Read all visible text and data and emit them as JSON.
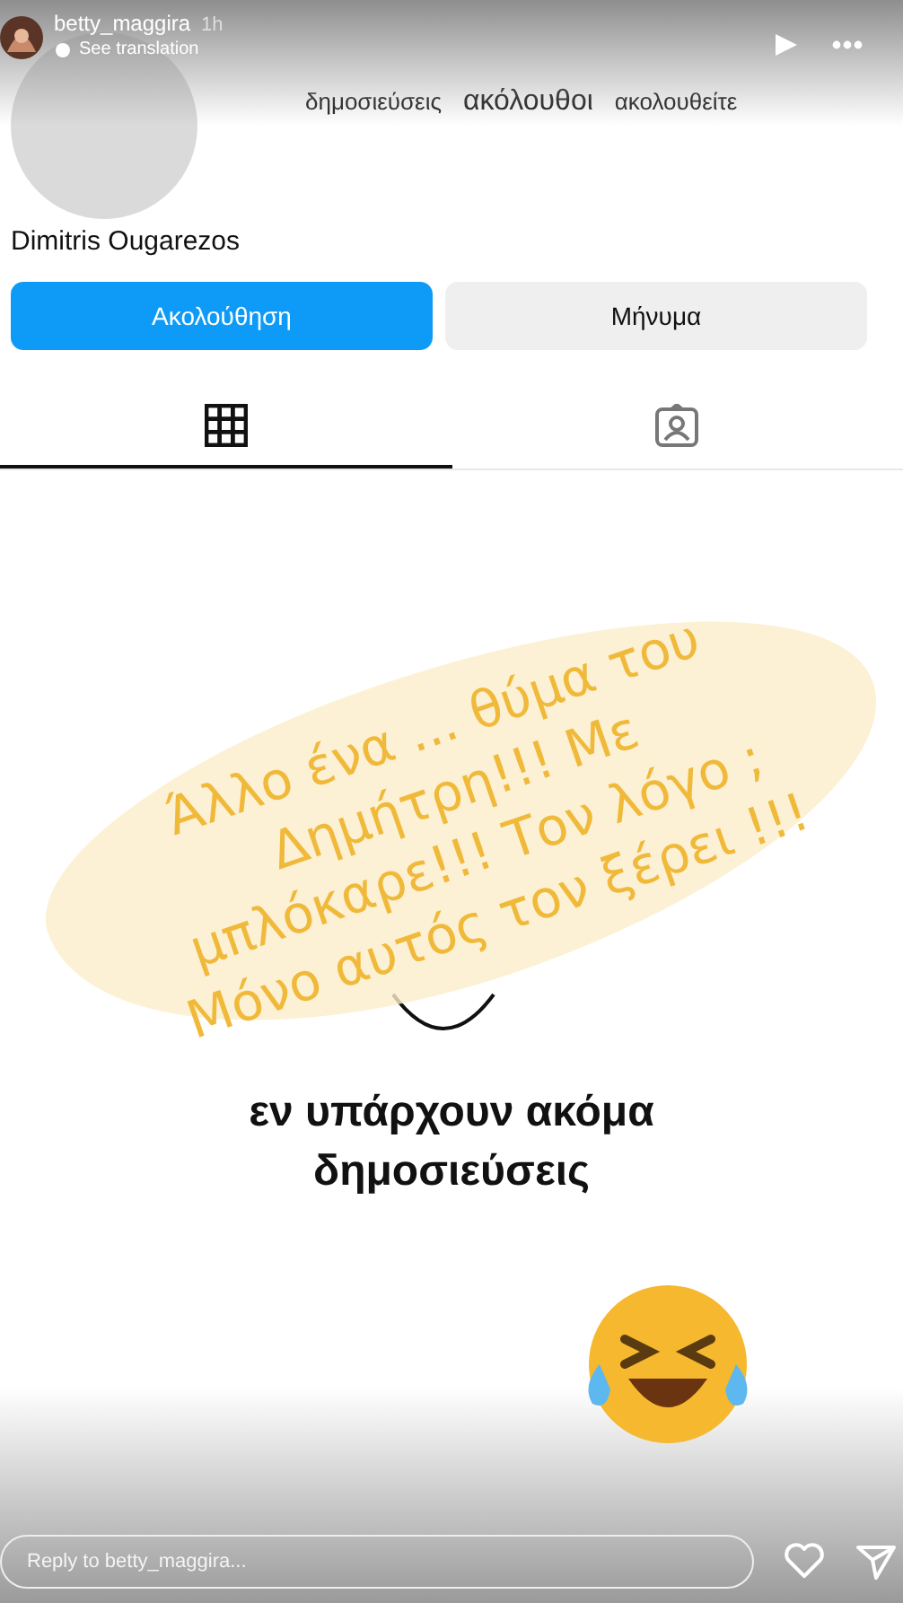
{
  "story": {
    "user": "betty_maggira",
    "time": "1h",
    "translate_label": "See translation",
    "reply_placeholder": "Reply to betty_maggira..."
  },
  "profile": {
    "stats": [
      {
        "label": "δημοσιεύσεις",
        "emphasis": false
      },
      {
        "label": "ακόλουθοι",
        "emphasis": true
      },
      {
        "label": "ακολουθείτε",
        "emphasis": false
      }
    ],
    "name": "Dimitris Ougarezos",
    "buttons": [
      {
        "label": "Ακολούθηση",
        "kind": "primary"
      },
      {
        "label": "Μήνυμα",
        "kind": "secondary"
      }
    ],
    "tabs": [
      {
        "kind": "grid",
        "selected": true
      },
      {
        "kind": "tagged",
        "selected": false
      }
    ],
    "empty_lines": [
      "εν υπάρχουν ακόμα",
      "δημοσιεύσεις"
    ]
  },
  "caption": {
    "lines": [
      "Άλλο ένα ... θύμα του",
      "Δημήτρη!!! Με",
      "μπλόκαρε!!! Τον λόγο ;",
      "Μόνο αυτός τον ξέρει !!!"
    ]
  }
}
